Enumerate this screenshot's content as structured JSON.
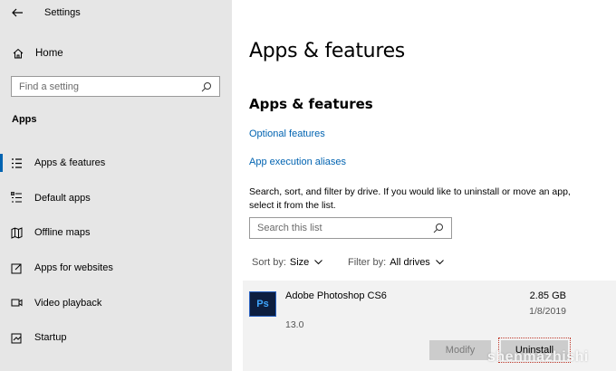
{
  "window": {
    "title": "Settings"
  },
  "sidebar": {
    "home_label": "Home",
    "search_placeholder": "Find a setting",
    "section_label": "Apps",
    "items": [
      {
        "label": "Apps & features",
        "icon": "apps-list-icon",
        "active": true
      },
      {
        "label": "Default apps",
        "icon": "default-apps-icon"
      },
      {
        "label": "Offline maps",
        "icon": "map-icon"
      },
      {
        "label": "Apps for websites",
        "icon": "open-link-icon"
      },
      {
        "label": "Video playback",
        "icon": "video-icon"
      },
      {
        "label": "Startup",
        "icon": "startup-icon"
      }
    ]
  },
  "main": {
    "page_title": "Apps & features",
    "section_title": "Apps & features",
    "links": [
      "Optional features",
      "App execution aliases"
    ],
    "description": "Search, sort, and filter by drive. If you would like to uninstall or move an app, select it from the list.",
    "search_placeholder": "Search this list",
    "sort_label": "Sort by:",
    "sort_value": "Size",
    "filter_label": "Filter by:",
    "filter_value": "All drives",
    "app": {
      "icon_text": "Ps",
      "name": "Adobe Photoshop CS6",
      "size": "2.85 GB",
      "date": "1/8/2019",
      "version": "13.0",
      "modify_label": "Modify",
      "uninstall_label": "Uninstall"
    }
  },
  "watermark": "shenmazhishi"
}
